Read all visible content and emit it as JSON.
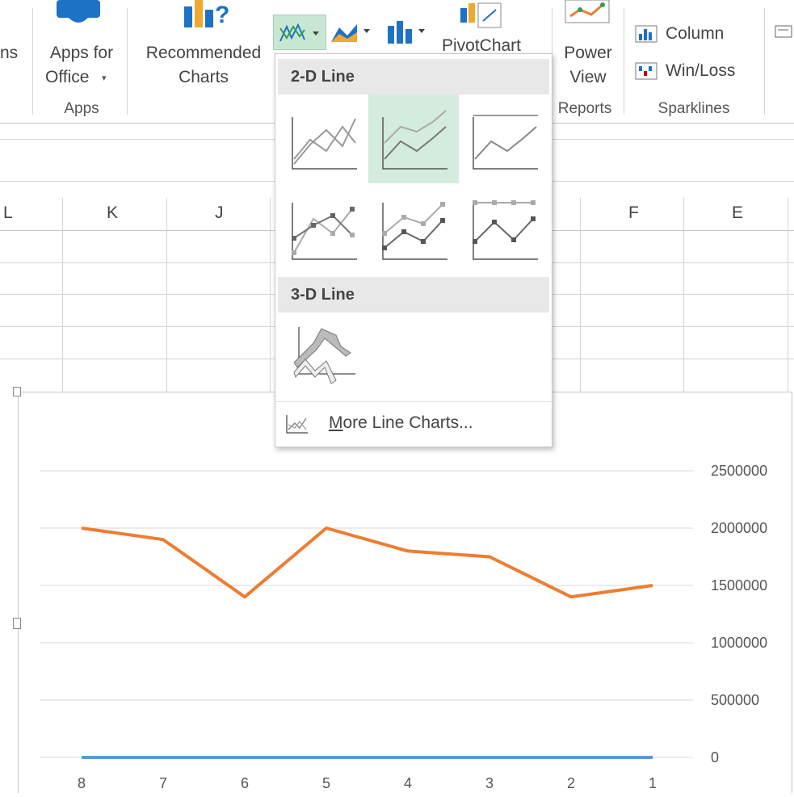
{
  "ribbon": {
    "partial_left": "ns",
    "apps_for_office": {
      "line1": "Apps for",
      "line2": "Office",
      "arrow": "▾"
    },
    "recommended_charts": {
      "line1": "Recommended",
      "line2": "Charts"
    },
    "pivotchart": "PivotChart",
    "power_view": {
      "line1": "Power",
      "line2": "View"
    },
    "sparklines": {
      "column": "Column",
      "winloss": "Win/Loss"
    },
    "groups": {
      "apps": "Apps",
      "reports": "Reports",
      "sparklines": "Sparklines"
    }
  },
  "columns": [
    "L",
    "K",
    "J",
    "F",
    "E"
  ],
  "dropdown": {
    "section_2d": "2-D Line",
    "section_3d": "3-D Line",
    "more": "More Line Charts...",
    "items_2d": [
      "line-icon",
      "stacked-line-icon",
      "100-stacked-line-icon",
      "line-with-markers-icon",
      "stacked-line-markers-icon",
      "100-stacked-line-markers-icon"
    ],
    "items_3d": [
      "3d-line-icon"
    ]
  },
  "chart_data": {
    "type": "line",
    "categories": [
      "8",
      "7",
      "6",
      "5",
      "4",
      "3",
      "2",
      "1"
    ],
    "series": [
      {
        "name": "",
        "color": "#ed7d31",
        "values": [
          2000000,
          1900000,
          1400000,
          2000000,
          1800000,
          1750000,
          1400000,
          1500000
        ]
      },
      {
        "name": "",
        "color": "#5b9bd5",
        "values": [
          0,
          0,
          0,
          0,
          0,
          0,
          0,
          0
        ]
      }
    ],
    "yticks": [
      "2500000",
      "2000000",
      "1500000",
      "1000000",
      "500000",
      "0"
    ],
    "ylim": [
      0,
      2500000
    ],
    "y_axis_position": "right",
    "grid": true
  }
}
